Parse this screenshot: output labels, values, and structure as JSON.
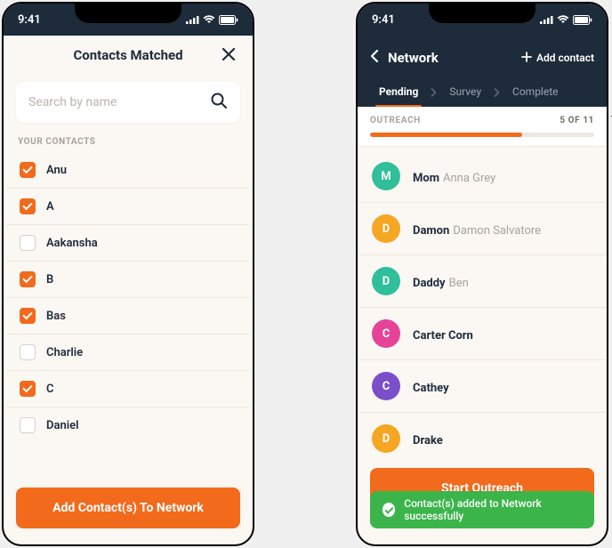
{
  "status_bar": {
    "time": "9:41"
  },
  "left": {
    "title": "Contacts Matched",
    "search_placeholder": "Search by name",
    "section_label": "YOUR CONTACTS",
    "contacts": [
      {
        "name": "Anu",
        "checked": true
      },
      {
        "name": "A",
        "checked": true
      },
      {
        "name": "Aakansha",
        "checked": false
      },
      {
        "name": "B",
        "checked": true
      },
      {
        "name": "Bas",
        "checked": true
      },
      {
        "name": "Charlie",
        "checked": false
      },
      {
        "name": "C",
        "checked": true
      },
      {
        "name": "Daniel",
        "checked": false
      }
    ],
    "cta": "Add Contact(s) To Network"
  },
  "right": {
    "nav_title": "Network",
    "add_contact_label": "Add contact",
    "tabs": {
      "pending": "Pending",
      "survey": "Survey",
      "complete": "Complete",
      "active": "pending"
    },
    "outreach_label": "OUTREACH",
    "outreach_count": "5 OF 11",
    "progress_pct": 68,
    "people": [
      {
        "letter": "M",
        "color": "av-teal",
        "name": "Mom",
        "sub": "Anna Grey"
      },
      {
        "letter": "D",
        "color": "av-orange",
        "name": "Damon",
        "sub": "Damon Salvatore"
      },
      {
        "letter": "D",
        "color": "av-green",
        "name": "Daddy",
        "sub": "Ben"
      },
      {
        "letter": "C",
        "color": "av-pink",
        "name": "Carter Corn",
        "sub": ""
      },
      {
        "letter": "C",
        "color": "av-purple",
        "name": "Cathey",
        "sub": ""
      },
      {
        "letter": "D",
        "color": "av-orange2",
        "name": "Drake",
        "sub": ""
      }
    ],
    "cta": "Start Outreach",
    "toast": "Contact(s) added to Network successfully"
  }
}
